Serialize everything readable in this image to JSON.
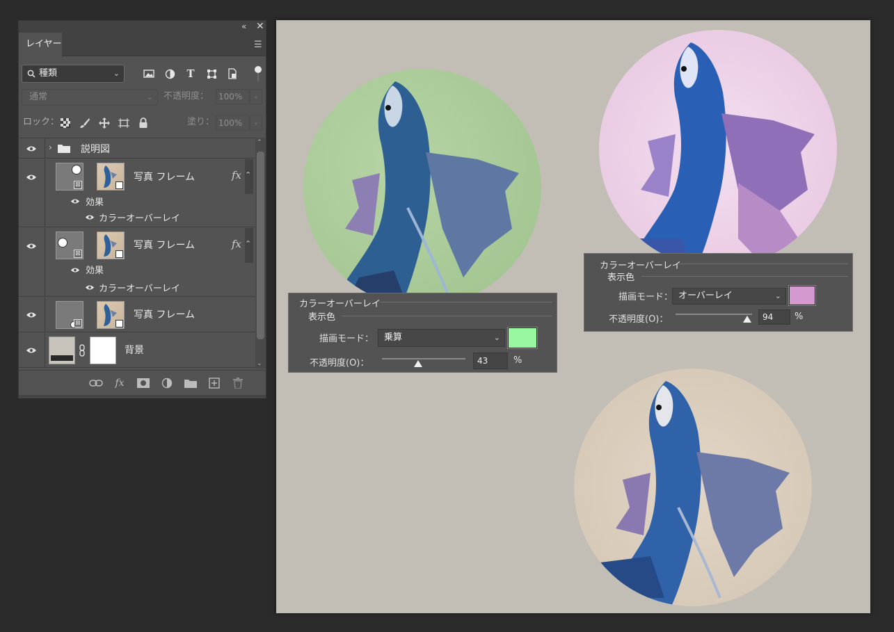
{
  "layers_panel": {
    "collapse_glyph": "«",
    "close_glyph": "✕",
    "tab_label": "レイヤー",
    "filter_kind": "種類",
    "blend_mode": "通常",
    "opacity_label": "不透明度：",
    "opacity_value": "100%",
    "lock_label": "ロック：",
    "fill_label": "塗り：",
    "fill_value": "100%",
    "layers": [
      {
        "name": "説明図",
        "type": "group"
      },
      {
        "name": "写真 フレーム",
        "fx": "fx",
        "effects_label": "効果",
        "effect_name": "カラーオーバーレイ"
      },
      {
        "name": "写真 フレーム",
        "fx": "fx",
        "effects_label": "効果",
        "effect_name": "カラーオーバーレイ"
      },
      {
        "name": "写真 フレーム"
      },
      {
        "name": "背景"
      }
    ]
  },
  "overlay_left": {
    "title": "カラーオーバーレイ",
    "subtitle": "表示色",
    "blend_label": "描画モード：",
    "blend_value": "乗算",
    "color": "#99f79f",
    "opacity_label": "不透明度(O)：",
    "opacity_value": "43",
    "opacity_fraction": 0.43,
    "percent": "%"
  },
  "overlay_right": {
    "title": "カラーオーバーレイ",
    "subtitle": "表示色",
    "blend_label": "描画モード：",
    "blend_value": "オーバーレイ",
    "color": "#d49ad0",
    "opacity_label": "不透明度(O)：",
    "opacity_value": "94",
    "opacity_fraction": 0.94,
    "percent": "%"
  },
  "colors": {
    "app_bg": "#2b2b2b",
    "panel_bg": "#535353",
    "canvas_bg": "#c2beb6",
    "frame_green": "#a9cb96",
    "frame_pink": "#ecd0e8",
    "frame_beige": "#dccdbb"
  },
  "icons": [
    "collapse-icon",
    "close-icon",
    "menu-icon",
    "search-icon",
    "image-filter-icon",
    "adjustment-filter-icon",
    "type-filter-icon",
    "shape-filter-icon",
    "smartobject-filter-icon",
    "lock-transparent-icon",
    "lock-paint-icon",
    "lock-move-icon",
    "lock-artboard-icon",
    "lock-all-icon",
    "eye-icon",
    "folder-icon",
    "chain-icon",
    "link-layers-icon",
    "fx-icon",
    "mask-icon",
    "adjustment-icon",
    "new-group-icon",
    "new-layer-icon",
    "trash-icon"
  ]
}
